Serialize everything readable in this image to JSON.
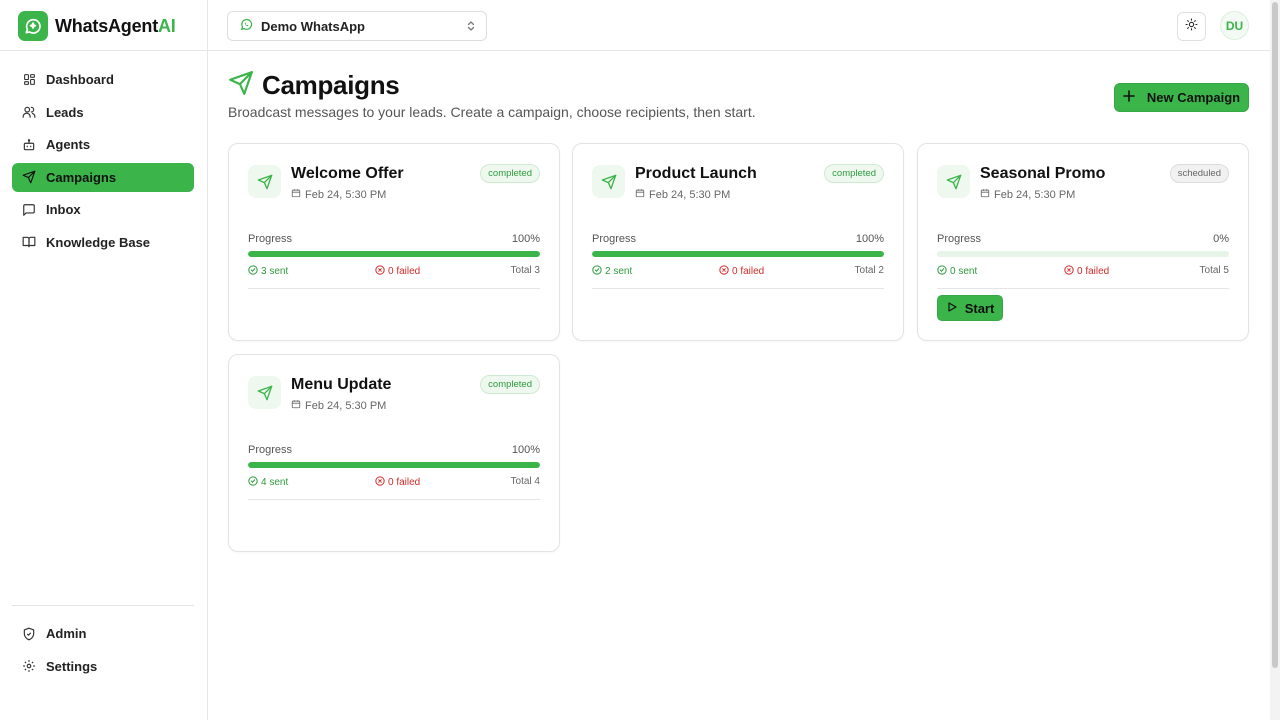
{
  "brand": {
    "name_main": "WhatsAgent",
    "name_accent": "AI",
    "logo_icon": "sparkle-chat-icon",
    "accent_color": "#3bb54a"
  },
  "sidebar": {
    "items": [
      {
        "label": "Dashboard",
        "icon": "dashboard-icon",
        "active": false
      },
      {
        "label": "Leads",
        "icon": "users-icon",
        "active": false
      },
      {
        "label": "Agents",
        "icon": "bot-icon",
        "active": false
      },
      {
        "label": "Campaigns",
        "icon": "send-icon",
        "active": true
      },
      {
        "label": "Inbox",
        "icon": "message-icon",
        "active": false
      },
      {
        "label": "Knowledge Base",
        "icon": "book-icon",
        "active": false
      }
    ],
    "bottom_items": [
      {
        "label": "Admin",
        "icon": "shield-icon"
      },
      {
        "label": "Settings",
        "icon": "gear-icon"
      }
    ]
  },
  "topbar": {
    "account": "Demo WhatsApp",
    "avatar_initials": "DU"
  },
  "page": {
    "title": "Campaigns",
    "subtitle": "Broadcast messages to your leads. Create a campaign, choose recipients, then start.",
    "new_button": "New Campaign"
  },
  "campaigns": [
    {
      "name": "Welcome Offer",
      "date": "Feb 24, 5:30 PM",
      "status": "completed",
      "progress_label": "Progress",
      "progress_pct": "100%",
      "progress": 1.0,
      "sent": "3 sent",
      "failed": "0 failed",
      "total": "Total 3"
    },
    {
      "name": "Product Launch",
      "date": "Feb 24, 5:30 PM",
      "status": "completed",
      "progress_label": "Progress",
      "progress_pct": "100%",
      "progress": 1.0,
      "sent": "2 sent",
      "failed": "0 failed",
      "total": "Total 2"
    },
    {
      "name": "Seasonal Promo",
      "date": "Feb 24, 5:30 PM",
      "status": "scheduled",
      "progress_label": "Progress",
      "progress_pct": "0%",
      "progress": 0.0,
      "sent": "0 sent",
      "failed": "0 failed",
      "total": "Total 5",
      "action": "Start"
    },
    {
      "name": "Menu Update",
      "date": "Feb 24, 5:30 PM",
      "status": "completed",
      "progress_label": "Progress",
      "progress_pct": "100%",
      "progress": 1.0,
      "sent": "4 sent",
      "failed": "0 failed",
      "total": "Total 4"
    }
  ]
}
